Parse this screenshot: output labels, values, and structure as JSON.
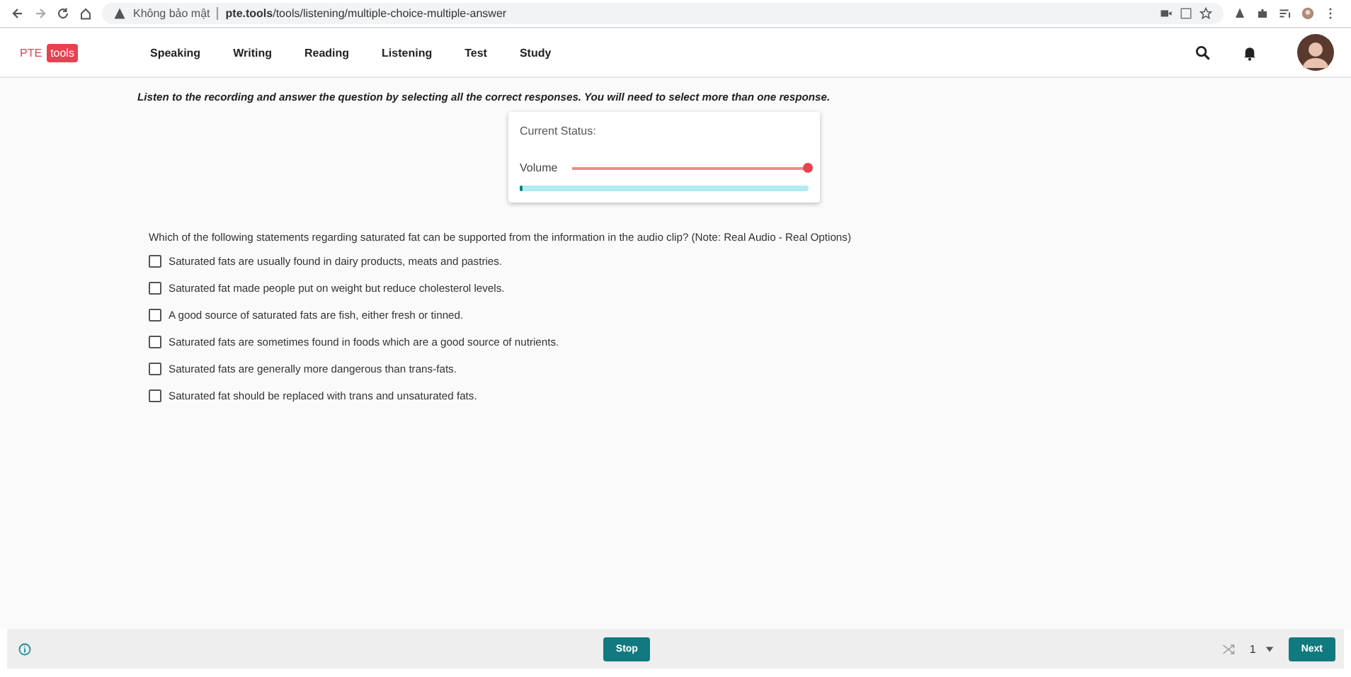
{
  "browser": {
    "security": "Không bảo mật",
    "url": "**pte.tools**/tools/listening/multiple-choice-multiple-answer"
  },
  "logo": {
    "left": "PTE",
    "right": "tools"
  },
  "nav": [
    {
      "label": "Speaking"
    },
    {
      "label": "Writing"
    },
    {
      "label": "Reading"
    },
    {
      "label": "Listening"
    },
    {
      "label": "Test"
    },
    {
      "label": "Study"
    }
  ],
  "instruction": "Listen to the recording and answer the question by selecting all the correct responses. You will need to select more than one response.",
  "status": {
    "title": "Current Status:",
    "volume": {
      "label": "Volume",
      "level": 1.0
    },
    "progress": {
      "level": 0.01
    }
  },
  "question": "Which of the following statements regarding saturated fat can be supported from the information in the audio clip? (Note: Real Audio - Real Options)",
  "options": [
    {
      "text": "Saturated fats are usually found in dairy products, meats and pastries.",
      "checked": false
    },
    {
      "text": "Saturated fat made people put on weight but reduce cholesterol levels.",
      "checked": false
    },
    {
      "text": "A good source of saturated fats are fish, either fresh or tinned.",
      "checked": false
    },
    {
      "text": "Saturated fats are sometimes found in foods which are a good source of nutrients.",
      "checked": false
    },
    {
      "text": "Saturated fats are generally more dangerous than trans-fats.",
      "checked": false
    },
    {
      "text": "Saturated fat should be replaced with trans and unsaturated fats.",
      "checked": false
    }
  ],
  "footer": {
    "stop": "Stop",
    "page": "1",
    "next": "Next"
  }
}
